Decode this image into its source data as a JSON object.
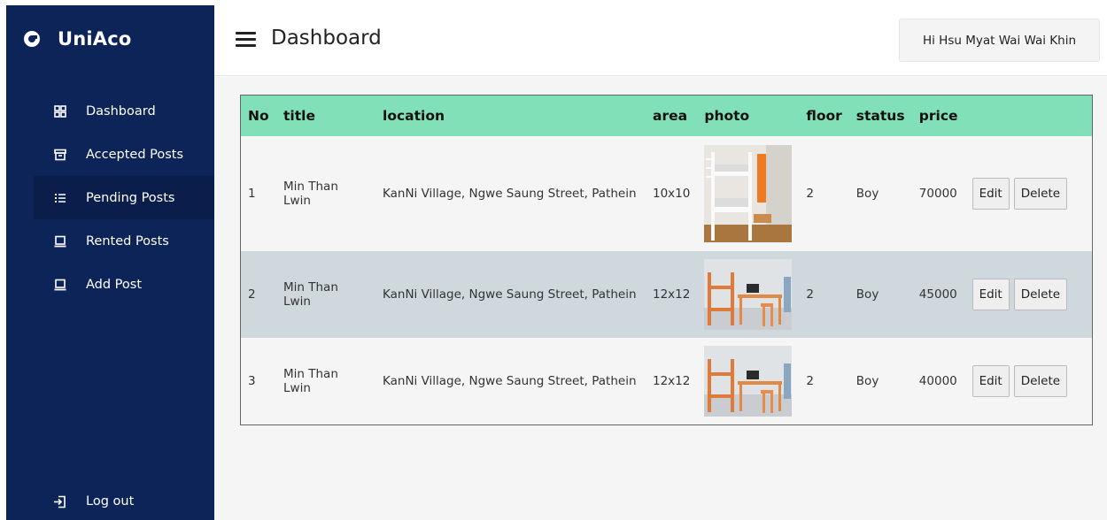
{
  "sidebar": {
    "brand": "UniAco",
    "items": [
      {
        "label": "Dashboard",
        "icon": "grid-icon"
      },
      {
        "label": "Accepted Posts",
        "icon": "archive-icon"
      },
      {
        "label": "Pending Posts",
        "icon": "list-icon",
        "active": true
      },
      {
        "label": "Rented Posts",
        "icon": "laptop-icon"
      },
      {
        "label": "Add Post",
        "icon": "laptop-icon"
      }
    ],
    "logout_label": "Log out"
  },
  "header": {
    "title": "Dashboard",
    "user_greeting": "Hi Hsu Myat Wai Wai Khin"
  },
  "table": {
    "columns": [
      "No",
      "title",
      "location",
      "area",
      "photo",
      "floor",
      "status",
      "price"
    ],
    "rows": [
      {
        "no": "1",
        "title": "Min Than Lwin",
        "location": "KanNi Village, Ngwe Saung Street, Pathein",
        "area": "10x10",
        "floor": "2",
        "status": "Boy",
        "price": "70000"
      },
      {
        "no": "2",
        "title": "Min Than Lwin",
        "location": "KanNi Village, Ngwe Saung Street, Pathein",
        "area": "12x12",
        "floor": "2",
        "status": "Boy",
        "price": "45000"
      },
      {
        "no": "3",
        "title": "Min Than Lwin",
        "location": "KanNi Village, Ngwe Saung Street, Pathein",
        "area": "12x12",
        "floor": "2",
        "status": "Boy",
        "price": "40000"
      }
    ],
    "edit_label": "Edit",
    "delete_label": "Delete"
  },
  "colors": {
    "sidebar_bg": "#0d2458",
    "sidebar_active": "#0a1d4b",
    "table_header": "#82e0b9",
    "row_highlight": "#cfd8dc"
  }
}
